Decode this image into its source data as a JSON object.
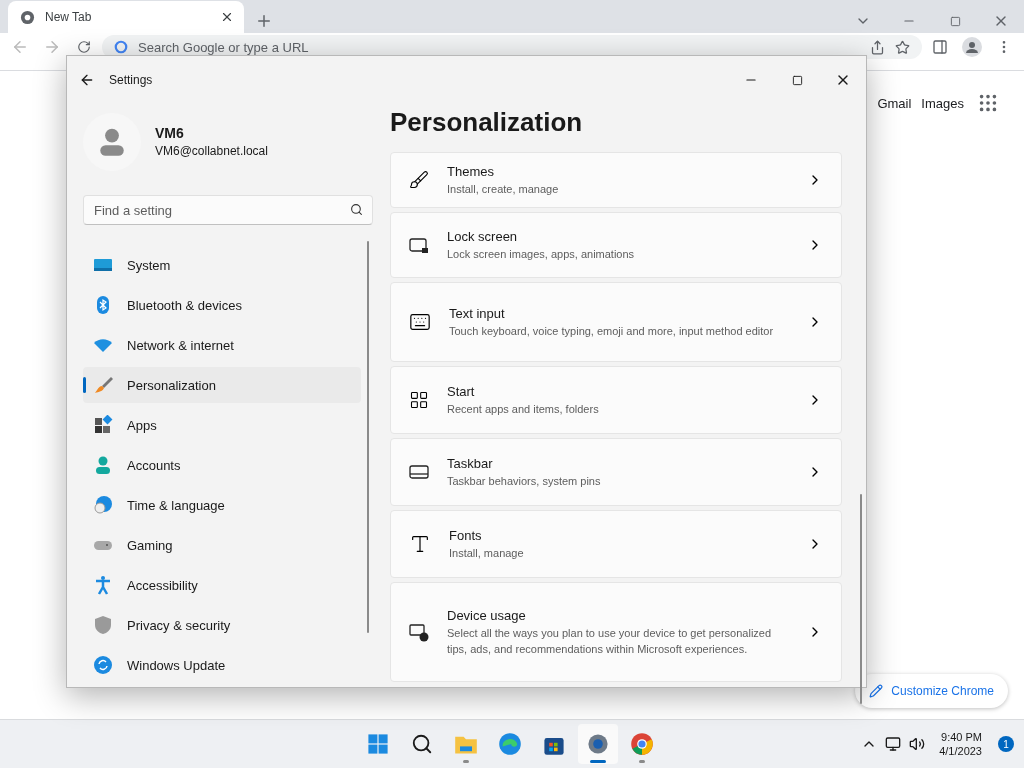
{
  "browser": {
    "tab": {
      "title": "New Tab"
    },
    "address_bar": {
      "placeholder": "Search Google or type a URL"
    },
    "links": [
      "Gmail",
      "Images"
    ],
    "customize_button": "Customize Chrome"
  },
  "settings": {
    "title": "Settings",
    "user": {
      "name": "VM6",
      "email": "VM6@collabnet.local"
    },
    "search": {
      "placeholder": "Find a setting"
    },
    "nav": [
      {
        "label": "System",
        "selected": false
      },
      {
        "label": "Bluetooth & devices",
        "selected": false
      },
      {
        "label": "Network & internet",
        "selected": false
      },
      {
        "label": "Personalization",
        "selected": true
      },
      {
        "label": "Apps",
        "selected": false
      },
      {
        "label": "Accounts",
        "selected": false
      },
      {
        "label": "Time & language",
        "selected": false
      },
      {
        "label": "Gaming",
        "selected": false
      },
      {
        "label": "Accessibility",
        "selected": false
      },
      {
        "label": "Privacy & security",
        "selected": false
      },
      {
        "label": "Windows Update",
        "selected": false
      }
    ],
    "heading": "Personalization",
    "items": [
      {
        "title": "Themes",
        "description": "Install, create, manage"
      },
      {
        "title": "Lock screen",
        "description": "Lock screen images, apps, animations"
      },
      {
        "title": "Text input",
        "description": "Touch keyboard, voice typing, emoji and more, input method editor"
      },
      {
        "title": "Start",
        "description": "Recent apps and items, folders"
      },
      {
        "title": "Taskbar",
        "description": "Taskbar behaviors, system pins"
      },
      {
        "title": "Fonts",
        "description": "Install, manage"
      },
      {
        "title": "Device usage",
        "description": "Select all the ways you plan to use your device to get personalized tips, ads, and recommendations within Microsoft experiences."
      }
    ]
  },
  "taskbar": {
    "apps": [
      {
        "running": false,
        "active": false
      },
      {
        "running": false,
        "active": false
      },
      {
        "running": true,
        "active": false
      },
      {
        "running": false,
        "active": false
      },
      {
        "running": false,
        "active": false
      },
      {
        "running": true,
        "active": true
      },
      {
        "running": true,
        "active": false
      }
    ],
    "time": "9:40 PM",
    "date": "4/1/2023",
    "notification_count": "1"
  }
}
